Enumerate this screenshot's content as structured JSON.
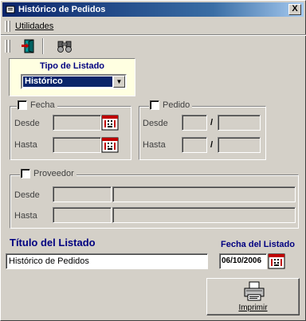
{
  "window": {
    "title": "Histórico de Pedidos",
    "close_label": "X"
  },
  "menu": {
    "items": [
      "Utilidades"
    ]
  },
  "toolbar": {
    "buttons": [
      "exit-door-icon",
      "binoculars-icon"
    ]
  },
  "tipo_listado": {
    "label": "Tipo de Listado",
    "selected": "Histórico"
  },
  "fecha": {
    "label": "Fecha",
    "checked": false,
    "desde_label": "Desde",
    "hasta_label": "Hasta",
    "desde_value": "",
    "hasta_value": ""
  },
  "pedido": {
    "label": "Pedido",
    "checked": false,
    "desde_label": "Desde",
    "hasta_label": "Hasta",
    "separator": "/"
  },
  "proveedor": {
    "label": "Proveedor",
    "checked": false,
    "desde_label": "Desde",
    "hasta_label": "Hasta"
  },
  "titulo_listado": {
    "label": "Título del Listado",
    "value": "Histórico de Pedidos"
  },
  "fecha_listado": {
    "label": "Fecha del Listado",
    "value": "06/10/2006"
  },
  "print": {
    "label": "Imprimir"
  },
  "colors": {
    "title_gradient_start": "#0a246a",
    "accent": "#000080",
    "panel_bg": "#ffffe1",
    "window_bg": "#d4d0c8"
  }
}
